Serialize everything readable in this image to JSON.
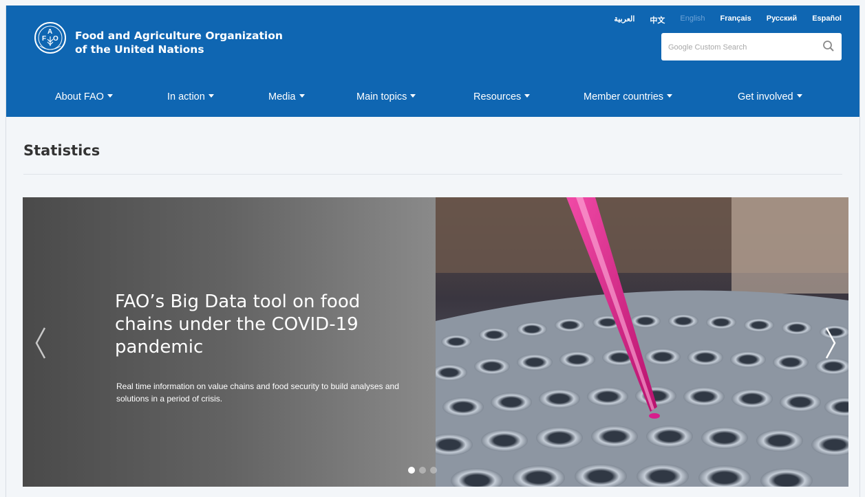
{
  "header": {
    "org_line1": "Food and Agriculture Organization",
    "org_line2": "of the United Nations",
    "logo_text": "FAO",
    "logo_motto": "FIAT PANIS",
    "languages": [
      "العربية",
      "中文",
      "English",
      "Français",
      "Русский",
      "Español"
    ],
    "active_language": "English",
    "search_placeholder": "Google Custom Search",
    "search_icon": "search-icon"
  },
  "nav": {
    "items": [
      "About FAO",
      "In action",
      "Media",
      "Main topics",
      "Resources",
      "Member countries",
      "Get involved"
    ]
  },
  "page": {
    "title": "Statistics"
  },
  "carousel": {
    "title": "FAO’s Big Data tool on food chains under the COVID-19 pandemic",
    "text": "Real time information on value chains and food security to build analyses and solutions in a period of crisis.",
    "prev_icon": "chevron-left-icon",
    "next_icon": "chevron-right-icon",
    "active_slide": 1,
    "slide_count": 3
  },
  "colors": {
    "brand_blue": "#0f66b2",
    "pipette_pink": "#d61f8c"
  }
}
